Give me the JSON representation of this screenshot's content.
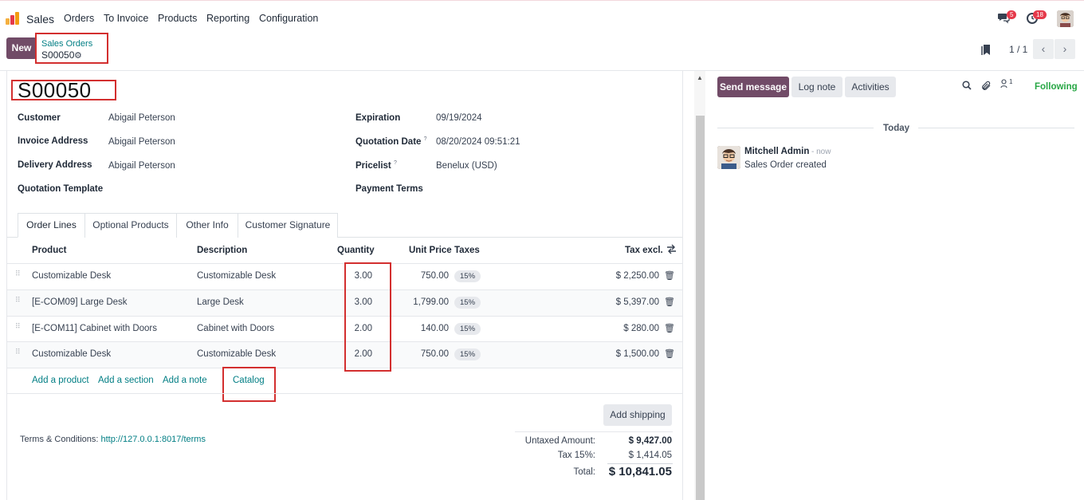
{
  "navbar": {
    "app_name": "Sales",
    "menus": [
      "Orders",
      "To Invoice",
      "Products",
      "Reporting",
      "Configuration"
    ],
    "messages_badge": "5",
    "activities_badge": "18"
  },
  "control": {
    "new_label": "New",
    "breadcrumb_parent": "Sales Orders",
    "breadcrumb_current": "S00050",
    "pager": "1 / 1"
  },
  "form": {
    "title": "S00050",
    "left_fields": [
      {
        "label": "Customer",
        "value": "Abigail Peterson"
      },
      {
        "label": "Invoice Address",
        "value": "Abigail Peterson"
      },
      {
        "label": "Delivery Address",
        "value": "Abigail Peterson"
      },
      {
        "label": "Quotation Template",
        "value": ""
      }
    ],
    "right_fields": [
      {
        "label": "Expiration",
        "help": "",
        "value": "09/19/2024"
      },
      {
        "label": "Quotation Date",
        "help": "?",
        "value": "08/20/2024 09:51:21"
      },
      {
        "label": "Pricelist",
        "help": "?",
        "value": "Benelux (USD)"
      },
      {
        "label": "Payment Terms",
        "help": "",
        "value": ""
      }
    ]
  },
  "tabs": [
    "Order Lines",
    "Optional Products",
    "Other Info",
    "Customer Signature"
  ],
  "table": {
    "headers": {
      "product": "Product",
      "description": "Description",
      "quantity": "Quantity",
      "unit_price": "Unit Price",
      "taxes": "Taxes",
      "tax_excl": "Tax excl."
    },
    "rows": [
      {
        "product": "Customizable Desk",
        "description": "Customizable Desk",
        "quantity": "3.00",
        "unit_price": "750.00",
        "tax": "15%",
        "subtotal": "$ 2,250.00"
      },
      {
        "product": "[E-COM09] Large Desk",
        "description": "Large Desk",
        "quantity": "3.00",
        "unit_price": "1,799.00",
        "tax": "15%",
        "subtotal": "$ 5,397.00"
      },
      {
        "product": "[E-COM11] Cabinet with Doors",
        "description": "Cabinet with Doors",
        "quantity": "2.00",
        "unit_price": "140.00",
        "tax": "15%",
        "subtotal": "$ 280.00"
      },
      {
        "product": "Customizable Desk",
        "description": "Customizable Desk",
        "quantity": "2.00",
        "unit_price": "750.00",
        "tax": "15%",
        "subtotal": "$ 1,500.00"
      }
    ],
    "add_links": {
      "product": "Add a product",
      "section": "Add a section",
      "note": "Add a note",
      "catalog": "Catalog"
    }
  },
  "footer": {
    "add_shipping": "Add shipping",
    "terms_label": "Terms & Conditions:",
    "terms_link": "http://127.0.0.1:8017/terms",
    "untaxed_label": "Untaxed Amount:",
    "untaxed_value": "$ 9,427.00",
    "tax_label": "Tax 15%:",
    "tax_value": "$ 1,414.05",
    "total_label": "Total:",
    "total_value": "$ 10,841.05"
  },
  "chatter": {
    "send_message": "Send message",
    "log_note": "Log note",
    "activities": "Activities",
    "followers_count": "1",
    "following": "Following",
    "date_separator": "Today",
    "author": "Mitchell Admin",
    "time": "- now",
    "body": "Sales Order created"
  },
  "colors": {
    "brand": "#714b67",
    "link": "#017e84",
    "highlight": "#d32f2f",
    "following": "#28a745"
  }
}
